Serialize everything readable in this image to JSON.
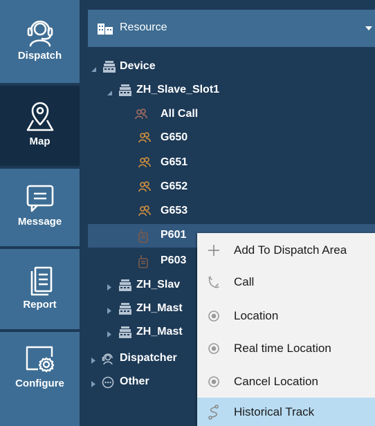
{
  "nav": {
    "items": [
      {
        "label": "Dispatch",
        "icon": "headset-icon"
      },
      {
        "label": "Map",
        "icon": "map-pin-icon"
      },
      {
        "label": "Message",
        "icon": "message-icon"
      },
      {
        "label": "Report",
        "icon": "report-icon"
      },
      {
        "label": "Configure",
        "icon": "configure-icon"
      }
    ],
    "active": "Map"
  },
  "resource": {
    "label": "Resource",
    "icon": "building-icon"
  },
  "tree": {
    "rows": [
      {
        "label": "Device",
        "icon": "device-icon",
        "expanded": true
      },
      {
        "label": "ZH_Slave_Slot1",
        "icon": "device-icon",
        "expanded": true
      },
      {
        "label": "All Call",
        "icon": "group-icon"
      },
      {
        "label": "G650",
        "icon": "group-icon"
      },
      {
        "label": "G651",
        "icon": "group-icon"
      },
      {
        "label": "G652",
        "icon": "group-icon"
      },
      {
        "label": "G653",
        "icon": "group-icon"
      },
      {
        "label": "P601",
        "icon": "radio-icon",
        "selected": true
      },
      {
        "label": "P603",
        "icon": "radio-icon"
      },
      {
        "label": "ZH_Slav",
        "icon": "device-icon",
        "expanded": false
      },
      {
        "label": "ZH_Mast",
        "icon": "device-icon",
        "expanded": false
      },
      {
        "label": "ZH_Mast",
        "icon": "device-icon",
        "expanded": false
      },
      {
        "label": "Dispatcher",
        "icon": "dispatcher-icon",
        "expanded": false
      },
      {
        "label": "Other",
        "icon": "more-icon",
        "expanded": false
      }
    ]
  },
  "context_menu": {
    "items": [
      {
        "label": "Add To Dispatch Area",
        "icon": "plus-icon"
      },
      {
        "label": "Call",
        "icon": "phone-icon"
      },
      {
        "label": "Location",
        "icon": "location-icon"
      },
      {
        "label": "Real time Location",
        "icon": "location-icon"
      },
      {
        "label": "Cancel Location",
        "icon": "location-icon"
      },
      {
        "label": "Historical Track",
        "icon": "track-icon",
        "hovered": true
      }
    ]
  },
  "colors": {
    "nav_bg": "#3d6d94",
    "nav_active_bg": "#142c44",
    "panel_bg": "#1d3a57",
    "selected_row_bg": "#33587e",
    "menu_bg": "#f2f2f2",
    "menu_hover_bg": "#b9dcf2"
  }
}
